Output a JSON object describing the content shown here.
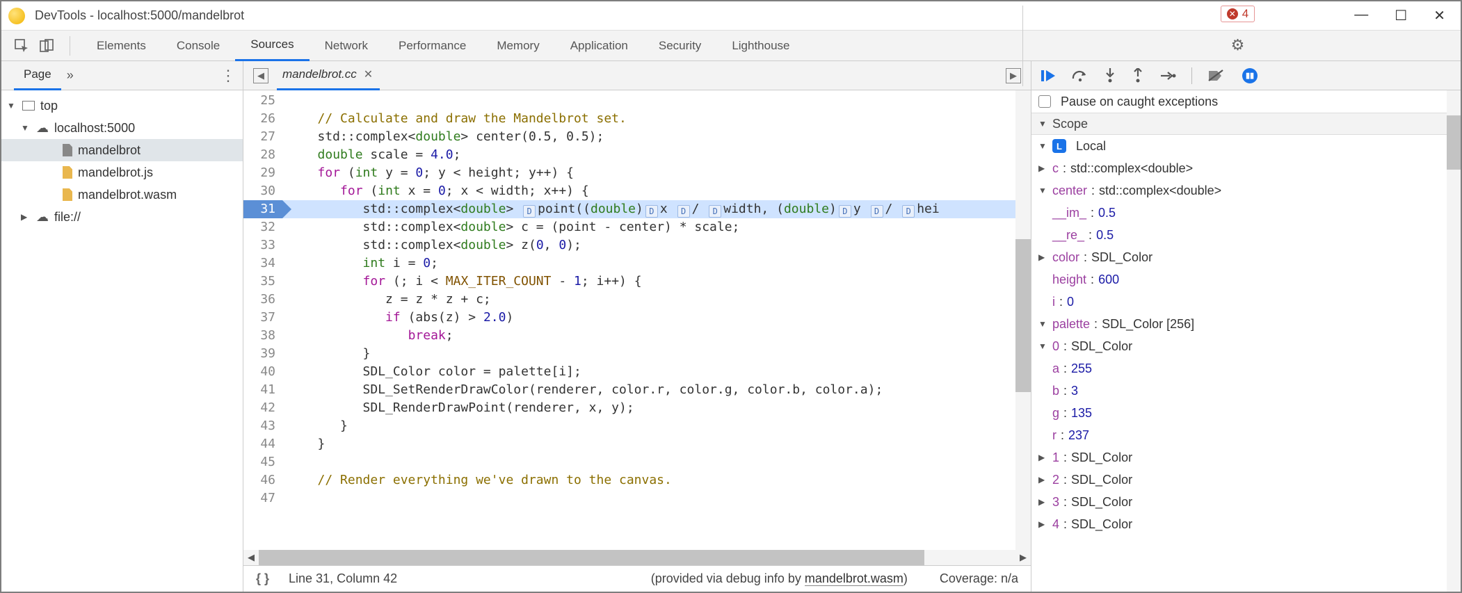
{
  "window": {
    "title": "DevTools - localhost:5000/mandelbrot"
  },
  "tabs": {
    "items": [
      "Elements",
      "Console",
      "Sources",
      "Network",
      "Performance",
      "Memory",
      "Application",
      "Security",
      "Lighthouse"
    ],
    "active": "Sources",
    "errorCount": "4"
  },
  "left": {
    "pageLabel": "Page",
    "tree": {
      "top": "top",
      "origin": "localhost:5000",
      "files": [
        "mandelbrot",
        "mandelbrot.js",
        "mandelbrot.wasm"
      ],
      "fileScheme": "file://"
    }
  },
  "editor": {
    "tab": {
      "name": "mandelbrot.cc"
    },
    "firstLine": 25,
    "breakpointLine": 31,
    "lines": {
      "25": "",
      "26": {
        "indent": 1,
        "comment": "// Calculate and draw the Mandelbrot set."
      },
      "27": {
        "indent": 1,
        "text": "std::complex<double> center(0.5, 0.5);"
      },
      "28": {
        "indent": 1,
        "html": "<span class='cm-type'>double</span> scale = <span class='cm-num'>4.0</span>;"
      },
      "29": {
        "indent": 1,
        "html": "<span class='cm-kw'>for</span> (<span class='cm-type'>int</span> y = <span class='cm-num'>0</span>; y &lt; height; y++) {"
      },
      "30": {
        "indent": 2,
        "html": "<span class='cm-kw'>for</span> (<span class='cm-type'>int</span> x = <span class='cm-num'>0</span>; x &lt; width; x++) {"
      },
      "31_tokens": {
        "pre": "std::complex<",
        "dbl": "double",
        "mid": "> ",
        "id": "point",
        "paren": "((",
        "dbl2": "double",
        "close": ")",
        "x": "x",
        "slash": "/",
        "width": "width",
        "comma": ", (",
        "dbl3": "double",
        "close2": ")",
        "y": "y",
        "slash2": "/",
        "hei": "hei"
      },
      "32": {
        "indent": 3,
        "html": "std::complex&lt;<span class='cm-type'>double</span>&gt; c = (point - center) * scale;"
      },
      "33": {
        "indent": 3,
        "html": "std::complex&lt;<span class='cm-type'>double</span>&gt; z(<span class='cm-num'>0</span>, <span class='cm-num'>0</span>);"
      },
      "34": {
        "indent": 3,
        "html": "<span class='cm-type'>int</span> i = <span class='cm-num'>0</span>;"
      },
      "35": {
        "indent": 3,
        "html": "<span class='cm-kw'>for</span> (; i &lt; <span class='cm-const'>MAX_ITER_COUNT</span> - <span class='cm-num'>1</span>; i++) {"
      },
      "36": {
        "indent": 4,
        "text": "z = z * z + c;"
      },
      "37": {
        "indent": 4,
        "html": "<span class='cm-kw'>if</span> (abs(z) &gt; <span class='cm-num'>2.0</span>)"
      },
      "38": {
        "indent": 5,
        "html": "<span class='cm-kw'>break</span>;"
      },
      "39": {
        "indent": 3,
        "text": "}"
      },
      "40": {
        "indent": 3,
        "text": "SDL_Color color = palette[i];"
      },
      "41": {
        "indent": 3,
        "text": "SDL_SetRenderDrawColor(renderer, color.r, color.g, color.b, color.a);"
      },
      "42": {
        "indent": 3,
        "text": "SDL_RenderDrawPoint(renderer, x, y);"
      },
      "43": {
        "indent": 2,
        "text": "}"
      },
      "44": {
        "indent": 1,
        "text": "}"
      },
      "45": "",
      "46": {
        "indent": 1,
        "comment": "// Render everything we've drawn to the canvas."
      },
      "47": ""
    },
    "footer": {
      "position": "Line 31, Column 42",
      "debugPrefix": "(provided via debug info by ",
      "debugFile": "mandelbrot.wasm",
      "debugSuffix": ")",
      "coverage": "Coverage: n/a"
    }
  },
  "debug": {
    "pauseCaught": "Pause on caught exceptions",
    "scopeHeader": "Scope",
    "local": "Local",
    "vars": {
      "c": {
        "name": "c",
        "type": "std::complex<double>"
      },
      "center": {
        "name": "center",
        "type": "std::complex<double>",
        "im": {
          "k": "__im_",
          "v": "0.5"
        },
        "re": {
          "k": "__re_",
          "v": "0.5"
        }
      },
      "color": {
        "name": "color",
        "type": "SDL_Color"
      },
      "height": {
        "name": "height",
        "val": "600"
      },
      "i": {
        "name": "i",
        "val": "0"
      },
      "palette": {
        "name": "palette",
        "type": "SDL_Color [256]",
        "0": {
          "k": "0",
          "t": "SDL_Color",
          "a": {
            "k": "a",
            "v": "255"
          },
          "b": {
            "k": "b",
            "v": "3"
          },
          "g": {
            "k": "g",
            "v": "135"
          },
          "r": {
            "k": "r",
            "v": "237"
          }
        },
        "1": {
          "k": "1",
          "t": "SDL_Color"
        },
        "2": {
          "k": "2",
          "t": "SDL_Color"
        },
        "3": {
          "k": "3",
          "t": "SDL_Color"
        },
        "4": {
          "k": "4",
          "t": "SDL_Color"
        }
      }
    }
  }
}
